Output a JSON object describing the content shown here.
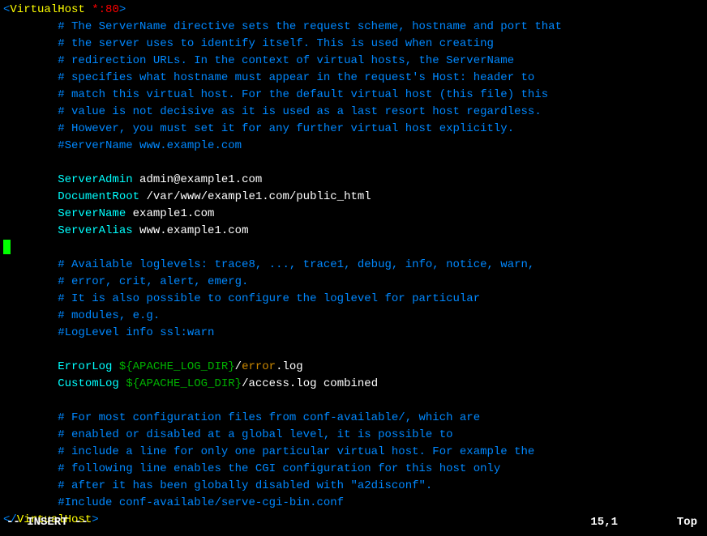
{
  "lines": [
    {
      "indent": 0,
      "parts": [
        {
          "text": "<",
          "c": "blue"
        },
        {
          "text": "VirtualHost",
          "c": "yellow"
        },
        {
          "text": " ",
          "c": "white"
        },
        {
          "text": "*:80",
          "c": "red"
        },
        {
          "text": ">",
          "c": "blue"
        }
      ]
    },
    {
      "indent": 2,
      "parts": [
        {
          "text": "# The ServerName directive sets the request scheme, hostname and port that",
          "c": "blue"
        }
      ]
    },
    {
      "indent": 2,
      "parts": [
        {
          "text": "# the server uses to identify itself. This is used when creating",
          "c": "blue"
        }
      ]
    },
    {
      "indent": 2,
      "parts": [
        {
          "text": "# redirection URLs. In the context of virtual hosts, the ServerName",
          "c": "blue"
        }
      ]
    },
    {
      "indent": 2,
      "parts": [
        {
          "text": "# specifies what hostname must appear in the request's Host: header to",
          "c": "blue"
        }
      ]
    },
    {
      "indent": 2,
      "parts": [
        {
          "text": "# match this virtual host. For the default virtual host (this file) this",
          "c": "blue"
        }
      ]
    },
    {
      "indent": 2,
      "parts": [
        {
          "text": "# value is not decisive as it is used as a last resort host regardless.",
          "c": "blue"
        }
      ]
    },
    {
      "indent": 2,
      "parts": [
        {
          "text": "# However, you must set it for any further virtual host explicitly.",
          "c": "blue"
        }
      ]
    },
    {
      "indent": 2,
      "parts": [
        {
          "text": "#ServerName www.example.com",
          "c": "blue"
        }
      ]
    },
    {
      "indent": 0,
      "parts": []
    },
    {
      "indent": 2,
      "parts": [
        {
          "text": "ServerAdmin",
          "c": "cyan"
        },
        {
          "text": " admin@example1.com",
          "c": "white"
        }
      ]
    },
    {
      "indent": 2,
      "parts": [
        {
          "text": "DocumentRoot",
          "c": "cyan"
        },
        {
          "text": " /var/www/example1.com/public_html",
          "c": "white"
        }
      ]
    },
    {
      "indent": 2,
      "parts": [
        {
          "text": "ServerName",
          "c": "cyan"
        },
        {
          "text": " example1.com",
          "c": "white"
        }
      ]
    },
    {
      "indent": 2,
      "parts": [
        {
          "text": "ServerAlias",
          "c": "cyan"
        },
        {
          "text": " www.example1.com",
          "c": "white"
        }
      ]
    },
    {
      "indent": 0,
      "cursor": true,
      "parts": []
    },
    {
      "indent": 2,
      "parts": [
        {
          "text": "# Available loglevels: trace8, ..., trace1, debug, info, notice, warn,",
          "c": "blue"
        }
      ]
    },
    {
      "indent": 2,
      "parts": [
        {
          "text": "# error, crit, alert, emerg.",
          "c": "blue"
        }
      ]
    },
    {
      "indent": 2,
      "parts": [
        {
          "text": "# It is also possible to configure the loglevel for particular",
          "c": "blue"
        }
      ]
    },
    {
      "indent": 2,
      "parts": [
        {
          "text": "# modules, e.g.",
          "c": "blue"
        }
      ]
    },
    {
      "indent": 2,
      "parts": [
        {
          "text": "#LogLevel info ssl:warn",
          "c": "blue"
        }
      ]
    },
    {
      "indent": 0,
      "parts": []
    },
    {
      "indent": 2,
      "parts": [
        {
          "text": "ErrorLog",
          "c": "cyan"
        },
        {
          "text": " ",
          "c": "white"
        },
        {
          "text": "${APACHE_LOG_DIR}",
          "c": "green"
        },
        {
          "text": "/",
          "c": "white"
        },
        {
          "text": "error",
          "c": "brown"
        },
        {
          "text": ".log",
          "c": "white"
        }
      ]
    },
    {
      "indent": 2,
      "parts": [
        {
          "text": "CustomLog",
          "c": "cyan"
        },
        {
          "text": " ",
          "c": "white"
        },
        {
          "text": "${APACHE_LOG_DIR}",
          "c": "green"
        },
        {
          "text": "/access.log combined",
          "c": "white"
        }
      ]
    },
    {
      "indent": 0,
      "parts": []
    },
    {
      "indent": 2,
      "parts": [
        {
          "text": "# For most configuration files from conf-available/, which are",
          "c": "blue"
        }
      ]
    },
    {
      "indent": 2,
      "parts": [
        {
          "text": "# enabled or disabled at a global level, it is possible to",
          "c": "blue"
        }
      ]
    },
    {
      "indent": 2,
      "parts": [
        {
          "text": "# include a line for only one particular virtual host. For example the",
          "c": "blue"
        }
      ]
    },
    {
      "indent": 2,
      "parts": [
        {
          "text": "# following line enables the CGI configuration for this host only",
          "c": "blue"
        }
      ]
    },
    {
      "indent": 2,
      "parts": [
        {
          "text": "# after it has been globally disabled with \"a2disconf\".",
          "c": "blue"
        }
      ]
    },
    {
      "indent": 2,
      "parts": [
        {
          "text": "#Include conf-available/serve-cgi-bin.conf",
          "c": "blue"
        }
      ]
    },
    {
      "indent": 0,
      "parts": [
        {
          "text": "</",
          "c": "blue"
        },
        {
          "text": "VirtualHost",
          "c": "yellow"
        },
        {
          "text": ">",
          "c": "blue"
        }
      ]
    }
  ],
  "status": {
    "mode": "-- INSERT --",
    "position": "15,1",
    "scroll": "Top"
  }
}
